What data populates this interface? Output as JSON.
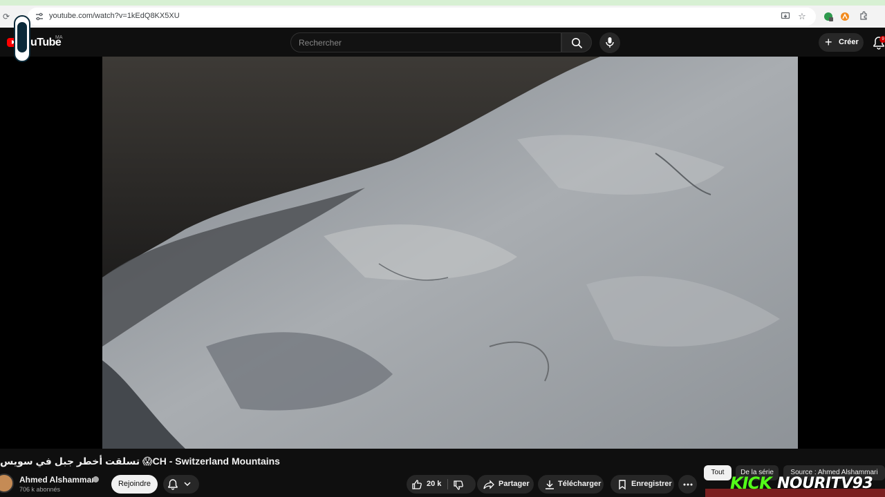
{
  "browser": {
    "url": "youtube.com/watch?v=1kEdQ8KX5XU"
  },
  "header": {
    "logo_text": "uTube",
    "country_code": "MA",
    "search_placeholder": "Rechercher",
    "create_label": "Créer",
    "notification_count": "9"
  },
  "video": {
    "title": "تسلقت أخطر جبل في سويس 😱CH - Switzerland Mountains"
  },
  "channel": {
    "name": "Ahmed Alshammari",
    "subscribers": "706 k abonnés",
    "join_label": "Rejoindre"
  },
  "actions": {
    "likes": "20 k",
    "share_label": "Partager",
    "download_label": "Télécharger",
    "save_label": "Enregistrer"
  },
  "chips": {
    "all": "Tout",
    "series": "De la série",
    "source": "Source : Ahmed Alshammari"
  },
  "watermark": {
    "kick": "KICK",
    "nouri": "NOURITV93"
  },
  "colors": {
    "page_bg": "#0f0f0f",
    "brand_red": "#ff0000",
    "kick_green": "#53fc18",
    "pill_bg": "#272727"
  }
}
